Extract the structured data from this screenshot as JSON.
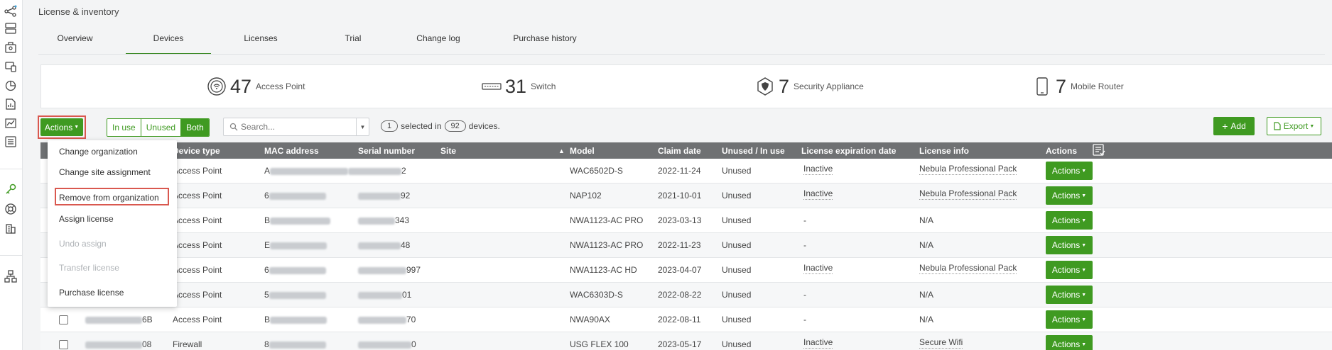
{
  "page": {
    "title": "License & inventory"
  },
  "tabs": [
    {
      "label": "Overview",
      "active": false
    },
    {
      "label": "Devices",
      "active": true
    },
    {
      "label": "Licenses",
      "active": false
    },
    {
      "label": "Trial",
      "active": false
    },
    {
      "label": "Change log",
      "active": false
    },
    {
      "label": "Purchase history",
      "active": false
    }
  ],
  "summary": [
    {
      "count": "47",
      "label": "Access Point",
      "icon": "access-point-icon"
    },
    {
      "count": "31",
      "label": "Switch",
      "icon": "switch-icon"
    },
    {
      "count": "7",
      "label": "Security Appliance",
      "icon": "security-appliance-icon"
    },
    {
      "count": "7",
      "label": "Mobile Router",
      "icon": "mobile-router-icon"
    }
  ],
  "toolbar": {
    "actions_label": "Actions",
    "filter": {
      "in_use": "In use",
      "unused": "Unused",
      "both": "Both",
      "selected": "Both"
    },
    "search_placeholder": "Search...",
    "selected_count": "1",
    "selected_mid": "selected in",
    "total_count": "92",
    "selected_suffix": "devices.",
    "add_label": "Add",
    "export_label": "Export"
  },
  "menu": {
    "items": [
      {
        "label": "Change organization",
        "enabled": true
      },
      {
        "label": "Change site assignment",
        "enabled": true
      },
      {
        "label": "Remove from organization",
        "enabled": true,
        "highlighted": true
      },
      {
        "label": "Assign license",
        "enabled": true
      },
      {
        "label": "Undo assign",
        "enabled": false
      },
      {
        "label": "Transfer license",
        "enabled": false
      },
      {
        "label": "Purchase license",
        "enabled": true
      }
    ]
  },
  "table": {
    "columns": [
      "Device type",
      "MAC address",
      "Serial number",
      "Site",
      "Model",
      "Claim date",
      "Unused / In use",
      "License expiration date",
      "License info",
      "Actions"
    ],
    "sort_indicator": "▲",
    "rows": [
      {
        "name_tail": "",
        "device_type": "Access Point",
        "mac_head": "A",
        "serial_tail": "2",
        "model": "WAC6502D-S",
        "claim_date": "2022-11-24",
        "use": "Unused",
        "expiration": "Inactive",
        "license_info": "Nebula Professional Pack",
        "action": "Actions"
      },
      {
        "name_tail": "",
        "device_type": "Access Point",
        "mac_head": "6",
        "serial_tail": "92",
        "model": "NAP102",
        "claim_date": "2021-10-01",
        "use": "Unused",
        "expiration": "Inactive",
        "license_info": "Nebula Professional Pack",
        "action": "Actions"
      },
      {
        "name_tail": "",
        "device_type": "Access Point",
        "mac_head": "B",
        "serial_tail": "343",
        "model": "NWA1123-AC PRO",
        "claim_date": "2023-03-13",
        "use": "Unused",
        "expiration": "-",
        "license_info": "N/A",
        "action": "Actions"
      },
      {
        "name_tail": "",
        "device_type": "Access Point",
        "mac_head": "E",
        "serial_tail": "48",
        "model": "NWA1123-AC PRO",
        "claim_date": "2022-11-23",
        "use": "Unused",
        "expiration": "-",
        "license_info": "N/A",
        "action": "Actions"
      },
      {
        "name_tail": "",
        "device_type": "Access Point",
        "mac_head": "6",
        "serial_tail": "997",
        "model": "NWA1123-AC HD",
        "claim_date": "2023-04-07",
        "use": "Unused",
        "expiration": "Inactive",
        "license_info": "Nebula Professional Pack",
        "action": "Actions"
      },
      {
        "name_tail": "",
        "device_type": "Access Point",
        "mac_head": "5",
        "serial_tail": "01",
        "model": "WAC6303D-S",
        "claim_date": "2022-08-22",
        "use": "Unused",
        "expiration": "-",
        "license_info": "N/A",
        "action": "Actions"
      },
      {
        "name_tail": "6B",
        "device_type": "Access Point",
        "mac_head": "B",
        "serial_tail": "70",
        "model": "NWA90AX",
        "claim_date": "2022-08-11",
        "use": "Unused",
        "expiration": "-",
        "license_info": "N/A",
        "action": "Actions"
      },
      {
        "name_tail": "08",
        "device_type": "Firewall",
        "mac_head": "8",
        "serial_tail": "0",
        "model": "USG FLEX 100",
        "claim_date": "2023-05-17",
        "use": "Unused",
        "expiration": "Inactive",
        "license_info": "Secure Wifi",
        "action": "Actions"
      }
    ]
  },
  "colors": {
    "accent": "#3f9a21",
    "header": "#6f7173",
    "highlight": "#d9584f"
  }
}
